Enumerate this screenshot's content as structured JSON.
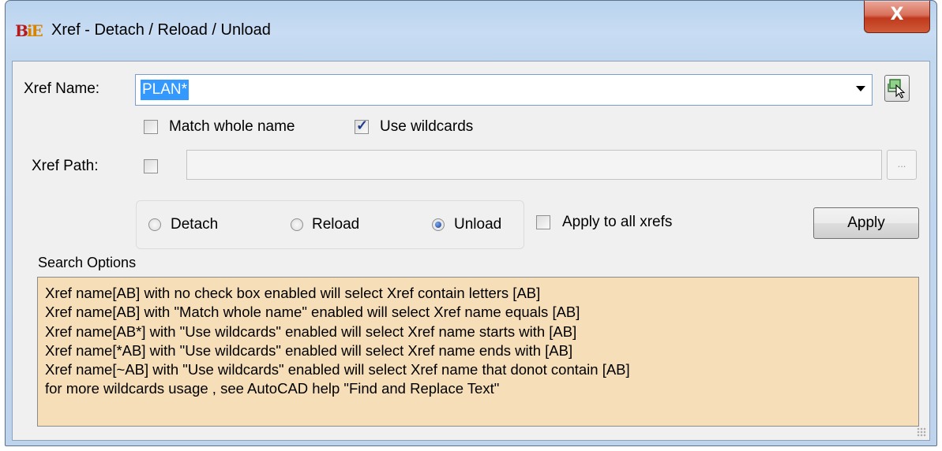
{
  "window": {
    "title": "Xref - Detach / Reload / Unload",
    "app_icon_text": "BiE",
    "close_label": "X"
  },
  "xref_name": {
    "label": "Xref Name:",
    "value": "PLAN*"
  },
  "match_whole_name": {
    "label": "Match whole name",
    "checked": false
  },
  "use_wildcards": {
    "label": "Use wildcards",
    "checked": true
  },
  "xref_path": {
    "label": "Xref  Path:",
    "checked": false,
    "value": "",
    "browse_label": "..."
  },
  "actions": {
    "detach_label": "Detach",
    "reload_label": "Reload",
    "unload_label": "Unload",
    "selected": "Unload",
    "apply_all_label": "Apply to all xrefs",
    "apply_all_checked": false,
    "apply_label": "Apply"
  },
  "search_options": {
    "title": "Search Options",
    "lines": [
      "Xref name[AB] with no check box enabled will select Xref contain letters [AB]",
      "Xref name[AB] with \"Match whole name\" enabled will select Xref name equals [AB]",
      "Xref name[AB*] with \"Use wildcards\" enabled will select Xref name starts with [AB]",
      "Xref name[*AB] with \"Use wildcards\" enabled will select Xref name ends with [AB]",
      "Xref name[~AB] with \"Use wildcards\" enabled will select Xref name that donot contain [AB]",
      "for more wildcards usage , see AutoCAD help  \"Find and Replace Text\""
    ]
  },
  "colors": {
    "info_background": "#f6deb8",
    "selection": "#3399ff",
    "close_button": "#c0391c"
  },
  "icons": {
    "pick": "select-object-icon",
    "dropdown": "chevron-down-icon"
  }
}
